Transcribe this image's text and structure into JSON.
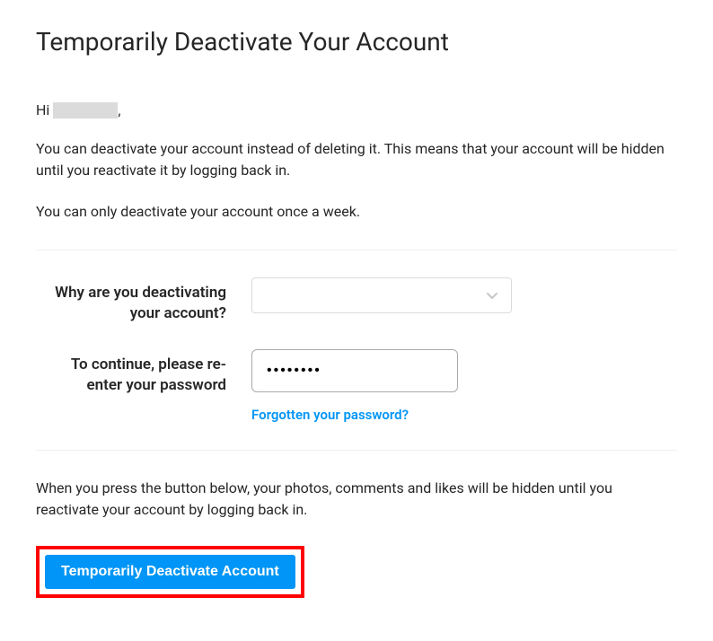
{
  "title": "Temporarily Deactivate Your Account",
  "greeting": {
    "prefix": "Hi",
    "suffix": ","
  },
  "description1": "You can deactivate your account instead of deleting it. This means that your account will be hidden until you reactivate it by logging back in.",
  "description2": "You can only deactivate your account once a week.",
  "form": {
    "reason_label": "Why are you deactivating your account?",
    "reason_value": "",
    "password_label": "To continue, please re-enter your password",
    "password_value": "••••••••",
    "forgot_link": "Forgotten your password?"
  },
  "description3": "When you press the button below, your photos, comments and likes will be hidden until you reactivate your account by logging back in.",
  "deactivate_button": "Temporarily Deactivate Account"
}
